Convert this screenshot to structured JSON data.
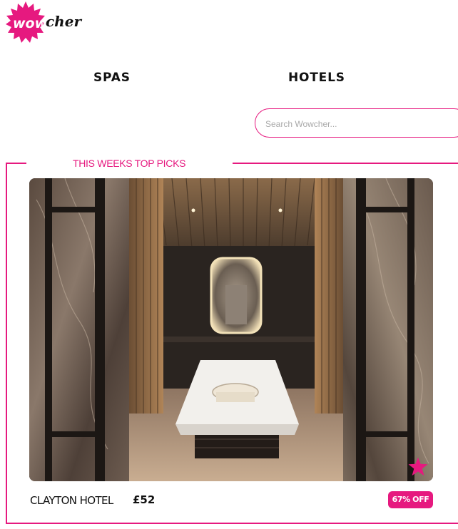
{
  "brand": {
    "logo_text_highlight": "wow",
    "logo_text_rest": "cher",
    "logo_icon": "starburst-logo-icon",
    "accent_color": "#e6197f"
  },
  "nav": {
    "items": [
      {
        "label": "SPAS"
      },
      {
        "label": "HOTELS"
      }
    ]
  },
  "search": {
    "placeholder": "Search Wowcher...",
    "value": ""
  },
  "picks": {
    "title": "THIS WEEKS TOP PICKS",
    "deal": {
      "name": "CLAYTON HOTEL",
      "price": "£52",
      "discount": "67% OFF",
      "favorite_icon": "star-icon"
    }
  }
}
